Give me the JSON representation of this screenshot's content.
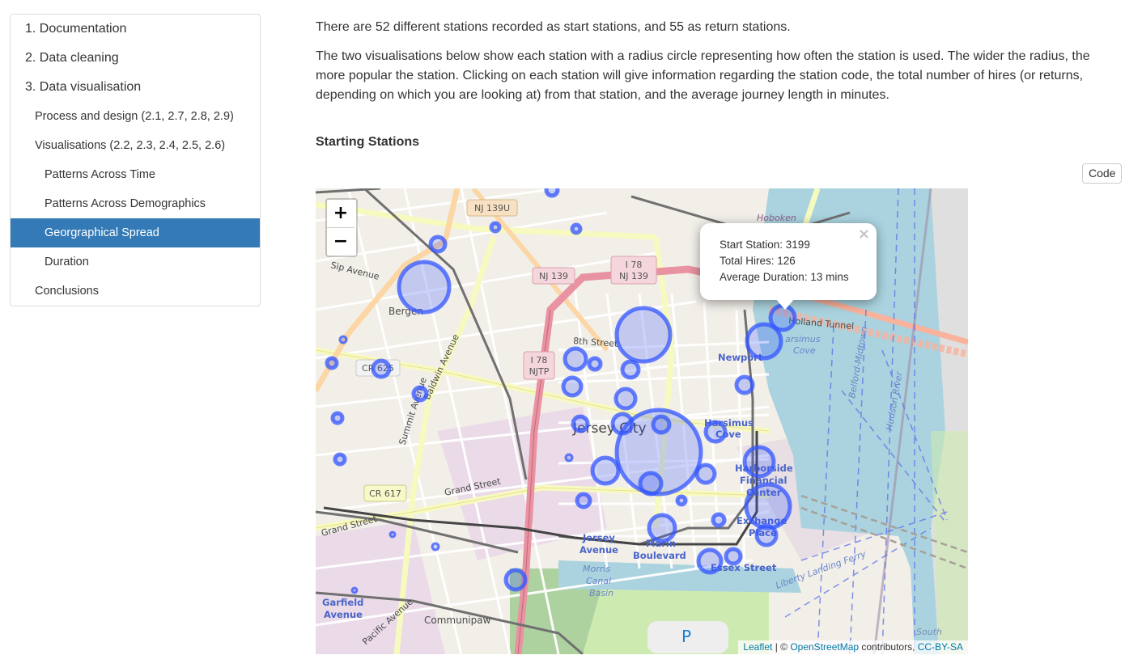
{
  "toc": {
    "items": [
      {
        "label": "1. Documentation",
        "level": 1,
        "active": false
      },
      {
        "label": "2. Data cleaning",
        "level": 1,
        "active": false
      },
      {
        "label": "3. Data visualisation",
        "level": 1,
        "active": false
      },
      {
        "label": "Process and design (2.1, 2.7, 2.8, 2.9)",
        "level": 2,
        "active": false
      },
      {
        "label": "Visualisations (2.2, 2.3, 2.4, 2.5, 2.6)",
        "level": 2,
        "active": false
      },
      {
        "label": "Patterns Across Time",
        "level": 3,
        "active": false
      },
      {
        "label": "Patterns Across Demographics",
        "level": 3,
        "active": false
      },
      {
        "label": "Georgraphical Spread",
        "level": 3,
        "active": true
      },
      {
        "label": "Duration",
        "level": 3,
        "active": false
      },
      {
        "label": "Conclusions",
        "level": 2,
        "active": false
      }
    ]
  },
  "main": {
    "paragraph1": "There are 52 different stations recorded as start stations, and 55 as return stations.",
    "paragraph2": "The two visualisations below show each station with a radius circle representing how often the station is used. The wider the radius, the more popular the station. Clicking on each station will give information regarding the station code, the total number of hires (or returns, depending on which you are looking at) from that station, and the average journey length in minutes.",
    "section_heading": "Starting Stations",
    "code_button": "Code"
  },
  "map": {
    "zoom_in": "+",
    "zoom_out": "−",
    "popup": {
      "close": "×",
      "line1": "Start Station: 3199",
      "line2": "Total Hires: 126",
      "line3": "Average Duration: 13 mins"
    },
    "attribution": {
      "leaflet": "Leaflet",
      "sep": " | © ",
      "osm": "OpenStreetMap",
      "contrib": " contributors, ",
      "license": "CC-BY-SA"
    },
    "marker_color": "#3355ff",
    "place_labels": [
      {
        "text": "Bergen",
        "kind": "area"
      },
      {
        "text": "Jersey City",
        "kind": "city"
      },
      {
        "text": "Newport",
        "kind": "station"
      },
      {
        "text": "Harsimus",
        "kind": "station"
      },
      {
        "text": "Cove",
        "kind": "station"
      },
      {
        "text": "Harborside",
        "kind": "station"
      },
      {
        "text": "Financial",
        "kind": "station"
      },
      {
        "text": "Center",
        "kind": "station"
      },
      {
        "text": "Exchange",
        "kind": "station"
      },
      {
        "text": "Place",
        "kind": "station"
      },
      {
        "text": "Jersey",
        "kind": "station"
      },
      {
        "text": "Avenue",
        "kind": "station"
      },
      {
        "text": "Marin",
        "kind": "station"
      },
      {
        "text": "Boulevard",
        "kind": "station"
      },
      {
        "text": "Essex Street",
        "kind": "station"
      },
      {
        "text": "Garfield",
        "kind": "station"
      },
      {
        "text": "Avenue",
        "kind": "station"
      },
      {
        "text": "Communipaw",
        "kind": "area"
      },
      {
        "text": "Hoboken",
        "kind": "area"
      },
      {
        "text": "Hudson River",
        "kind": "water"
      },
      {
        "text": "Morris",
        "kind": "water"
      },
      {
        "text": "Canal",
        "kind": "water"
      },
      {
        "text": "Basin",
        "kind": "water"
      },
      {
        "text": "Holland Tunnel",
        "kind": "road"
      },
      {
        "text": "8th Street",
        "kind": "road"
      },
      {
        "text": "Sip Avenue",
        "kind": "road"
      },
      {
        "text": "Grand Street",
        "kind": "road"
      },
      {
        "text": "Grand Street",
        "kind": "road"
      },
      {
        "text": "Summit Avenue",
        "kind": "road"
      },
      {
        "text": "Baldwin Avenue",
        "kind": "road"
      },
      {
        "text": "Pacific Avenue",
        "kind": "road"
      },
      {
        "text": "Liberty Landing Ferry",
        "kind": "ferry"
      },
      {
        "text": "Belford-Midtown",
        "kind": "ferry"
      },
      {
        "text": "South",
        "kind": "area"
      },
      {
        "text": "P",
        "kind": "parking"
      }
    ],
    "shields": [
      {
        "text": "NJ 139U",
        "type": "state"
      },
      {
        "text": "NJ 139",
        "type": "state-pink"
      },
      {
        "text": "I 78 / NJ 139",
        "type": "interstate"
      },
      {
        "text": "I 78 / NJTP",
        "type": "interstate"
      },
      {
        "text": "CR 625",
        "type": "county"
      },
      {
        "text": "CR 617",
        "type": "county"
      }
    ]
  }
}
